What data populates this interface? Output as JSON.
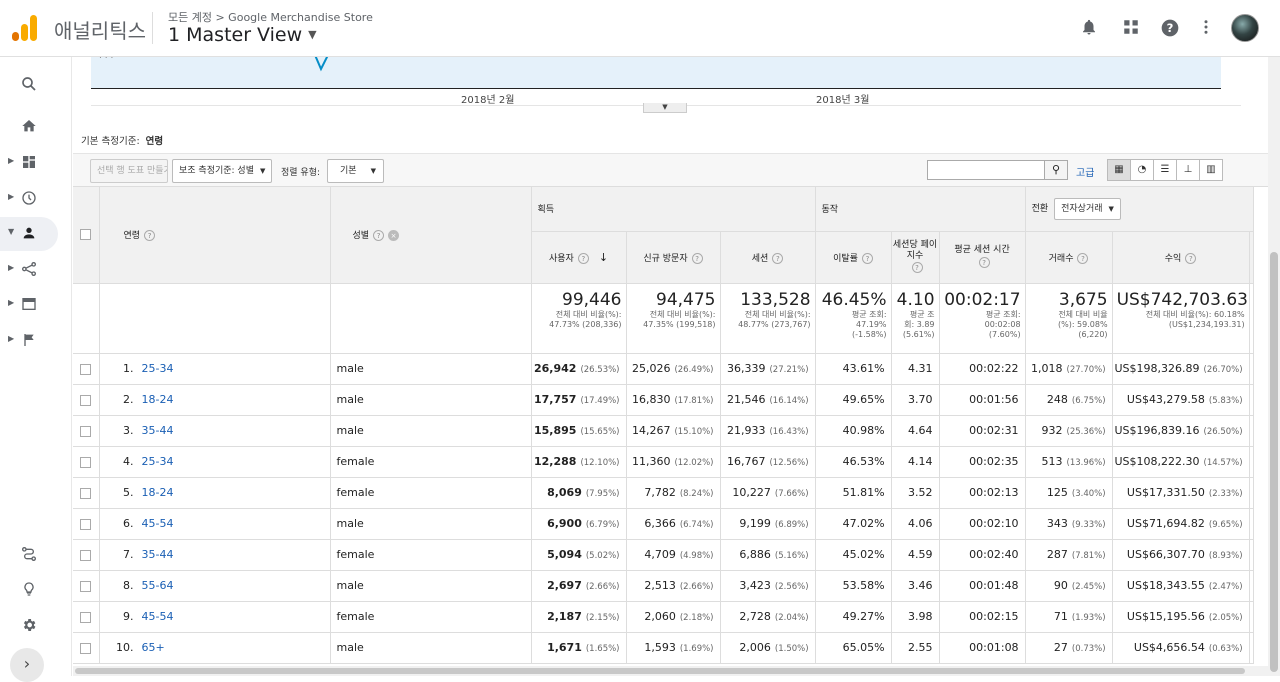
{
  "header": {
    "app_name": "애널리틱스",
    "breadcrumb": "모든 계정 > Google Merchandise Store",
    "view_name": "1 Master View",
    "brand_colors": {
      "orange": "#f9ab00",
      "dark_orange": "#e37400"
    }
  },
  "header_icons": [
    "bell-icon",
    "apps-icon",
    "help-icon",
    "more-vert-icon"
  ],
  "chart_area": {
    "date_labels": [
      "2018년 2월",
      "2018년 3월"
    ]
  },
  "primary_dimension": {
    "label": "기본 측정기준:",
    "value": "연령"
  },
  "toolbar": {
    "create_pivot": "선택 행 도표 만들기",
    "secondary_dimension": "보조 측정기준: 성별",
    "sort_label": "정렬 유형:",
    "sort_value": "기본",
    "advanced": "고급"
  },
  "table": {
    "groups": {
      "acquisition": "획득",
      "behavior": "동작",
      "conversion": "전환",
      "conversion_select": "전자상거래"
    },
    "col_age": "연령",
    "col_gender": "성별",
    "cols": {
      "users": "사용자",
      "new_users": "신규 방문자",
      "sessions": "세션",
      "bounce": "이탈률",
      "pages": "세션당 페이지수",
      "duration": "평균 세션 시간",
      "transactions": "거래수",
      "revenue": "수익"
    },
    "totals": {
      "users": {
        "v": "99,446",
        "s1": "전체 대비 비율(%):",
        "s2": "47.73% (208,336)"
      },
      "new_users": {
        "v": "94,475",
        "s1": "전체 대비 비율(%):",
        "s2": "47.35% (199,518)"
      },
      "sessions": {
        "v": "133,528",
        "s1": "전체 대비 비율(%):",
        "s2": "48.77% (273,767)"
      },
      "bounce": {
        "v": "46.45%",
        "s1": "평균 조회:",
        "s2": "47.19%",
        "s3": "(-1.58%)"
      },
      "pages": {
        "v": "4.10",
        "s1": "평균 조",
        "s2": "회: 3.89",
        "s3": "(5.61%)"
      },
      "duration": {
        "v": "00:02:17",
        "s1": "평균 조회:",
        "s2": "00:02:08",
        "s3": "(7.60%)"
      },
      "transactions": {
        "v": "3,675",
        "s1": "전체 대비 비율",
        "s2": "(%): 59.08%",
        "s3": "(6,220)"
      },
      "revenue": {
        "v": "US$742,703.63",
        "s1": "전체 대비 비율(%): 60.18%",
        "s2": "(US$1,234,193.31)"
      }
    },
    "rows": [
      {
        "n": "1.",
        "age": "25-34",
        "gender": "male",
        "users": "26,942",
        "users_p": "(26.53%)",
        "new": "25,026",
        "new_p": "(26.49%)",
        "sess": "36,339",
        "sess_p": "(27.21%)",
        "bounce": "43.61%",
        "pages": "4.31",
        "dur": "00:02:22",
        "tx": "1,018",
        "tx_p": "(27.70%)",
        "rev": "US$198,326.89",
        "rev_p": "(26.70%)"
      },
      {
        "n": "2.",
        "age": "18-24",
        "gender": "male",
        "users": "17,757",
        "users_p": "(17.49%)",
        "new": "16,830",
        "new_p": "(17.81%)",
        "sess": "21,546",
        "sess_p": "(16.14%)",
        "bounce": "49.65%",
        "pages": "3.70",
        "dur": "00:01:56",
        "tx": "248",
        "tx_p": "(6.75%)",
        "rev": "US$43,279.58",
        "rev_p": "(5.83%)"
      },
      {
        "n": "3.",
        "age": "35-44",
        "gender": "male",
        "users": "15,895",
        "users_p": "(15.65%)",
        "new": "14,267",
        "new_p": "(15.10%)",
        "sess": "21,933",
        "sess_p": "(16.43%)",
        "bounce": "40.98%",
        "pages": "4.64",
        "dur": "00:02:31",
        "tx": "932",
        "tx_p": "(25.36%)",
        "rev": "US$196,839.16",
        "rev_p": "(26.50%)"
      },
      {
        "n": "4.",
        "age": "25-34",
        "gender": "female",
        "users": "12,288",
        "users_p": "(12.10%)",
        "new": "11,360",
        "new_p": "(12.02%)",
        "sess": "16,767",
        "sess_p": "(12.56%)",
        "bounce": "46.53%",
        "pages": "4.14",
        "dur": "00:02:35",
        "tx": "513",
        "tx_p": "(13.96%)",
        "rev": "US$108,222.30",
        "rev_p": "(14.57%)"
      },
      {
        "n": "5.",
        "age": "18-24",
        "gender": "female",
        "users": "8,069",
        "users_p": "(7.95%)",
        "new": "7,782",
        "new_p": "(8.24%)",
        "sess": "10,227",
        "sess_p": "(7.66%)",
        "bounce": "51.81%",
        "pages": "3.52",
        "dur": "00:02:13",
        "tx": "125",
        "tx_p": "(3.40%)",
        "rev": "US$17,331.50",
        "rev_p": "(2.33%)"
      },
      {
        "n": "6.",
        "age": "45-54",
        "gender": "male",
        "users": "6,900",
        "users_p": "(6.79%)",
        "new": "6,366",
        "new_p": "(6.74%)",
        "sess": "9,199",
        "sess_p": "(6.89%)",
        "bounce": "47.02%",
        "pages": "4.06",
        "dur": "00:02:10",
        "tx": "343",
        "tx_p": "(9.33%)",
        "rev": "US$71,694.82",
        "rev_p": "(9.65%)"
      },
      {
        "n": "7.",
        "age": "35-44",
        "gender": "female",
        "users": "5,094",
        "users_p": "(5.02%)",
        "new": "4,709",
        "new_p": "(4.98%)",
        "sess": "6,886",
        "sess_p": "(5.16%)",
        "bounce": "45.02%",
        "pages": "4.59",
        "dur": "00:02:40",
        "tx": "287",
        "tx_p": "(7.81%)",
        "rev": "US$66,307.70",
        "rev_p": "(8.93%)"
      },
      {
        "n": "8.",
        "age": "55-64",
        "gender": "male",
        "users": "2,697",
        "users_p": "(2.66%)",
        "new": "2,513",
        "new_p": "(2.66%)",
        "sess": "3,423",
        "sess_p": "(2.56%)",
        "bounce": "53.58%",
        "pages": "3.46",
        "dur": "00:01:48",
        "tx": "90",
        "tx_p": "(2.45%)",
        "rev": "US$18,343.55",
        "rev_p": "(2.47%)"
      },
      {
        "n": "9.",
        "age": "45-54",
        "gender": "female",
        "users": "2,187",
        "users_p": "(2.15%)",
        "new": "2,060",
        "new_p": "(2.18%)",
        "sess": "2,728",
        "sess_p": "(2.04%)",
        "bounce": "49.27%",
        "pages": "3.98",
        "dur": "00:02:15",
        "tx": "71",
        "tx_p": "(1.93%)",
        "rev": "US$15,195.56",
        "rev_p": "(2.05%)"
      },
      {
        "n": "10.",
        "age": "65+",
        "gender": "male",
        "users": "1,671",
        "users_p": "(1.65%)",
        "new": "1,593",
        "new_p": "(1.69%)",
        "sess": "2,006",
        "sess_p": "(1.50%)",
        "bounce": "65.05%",
        "pages": "2.55",
        "dur": "00:01:08",
        "tx": "27",
        "tx_p": "(0.73%)",
        "rev": "US$4,656.54",
        "rev_p": "(0.63%)"
      }
    ]
  }
}
